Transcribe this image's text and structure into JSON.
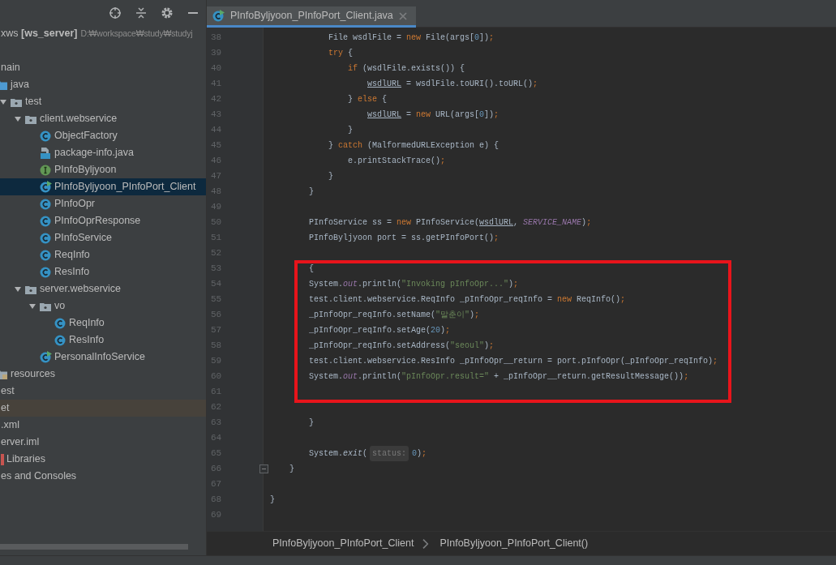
{
  "project_panel": {
    "header_row": "xws **[ws_server]**",
    "header_path": "D:₩workspace₩study₩studyj",
    "tree": [
      {
        "label": "nain",
        "kind": "item",
        "selected": false,
        "children": [
          {
            "label": "java",
            "kind": "source-folder",
            "selected": false,
            "children": [
              {
                "label": "test",
                "kind": "package",
                "selected": false,
                "expanded": true,
                "children": [
                  {
                    "label": "client.webservice",
                    "kind": "package",
                    "selected": false,
                    "expanded": true,
                    "children": [
                      {
                        "label": "ObjectFactory",
                        "kind": "class",
                        "selected": false
                      },
                      {
                        "label": "package-info.java",
                        "kind": "file",
                        "selected": false
                      },
                      {
                        "label": "PInfoByljyoon",
                        "kind": "interface",
                        "selected": false
                      },
                      {
                        "label": "PInfoByljyoon_PInfoPort_Client",
                        "kind": "runnable",
                        "selected": true
                      },
                      {
                        "label": "PInfoOpr",
                        "kind": "class",
                        "selected": false
                      },
                      {
                        "label": "PInfoOprResponse",
                        "kind": "class",
                        "selected": false
                      },
                      {
                        "label": "PInfoService",
                        "kind": "class",
                        "selected": false
                      },
                      {
                        "label": "ReqInfo",
                        "kind": "class",
                        "selected": false
                      },
                      {
                        "label": "ResInfo",
                        "kind": "class",
                        "selected": false
                      }
                    ]
                  },
                  {
                    "label": "server.webservice",
                    "kind": "package",
                    "selected": false,
                    "expanded": true,
                    "children": [
                      {
                        "label": "vo",
                        "kind": "package",
                        "selected": false,
                        "expanded": true,
                        "children": [
                          {
                            "label": "ReqInfo",
                            "kind": "class",
                            "selected": false
                          },
                          {
                            "label": "ResInfo",
                            "kind": "class",
                            "selected": false
                          }
                        ]
                      },
                      {
                        "label": "PersonalInfoService",
                        "kind": "runnable",
                        "selected": false
                      }
                    ]
                  }
                ]
              }
            ]
          },
          {
            "label": "resources",
            "kind": "resource-folder",
            "selected": false
          }
        ]
      },
      {
        "label": "est",
        "kind": "item",
        "selected": false
      },
      {
        "label": "et",
        "kind": "excluded-item",
        "selected": false
      },
      {
        "label": ".xml",
        "kind": "item",
        "selected": false
      },
      {
        "label": "erver.iml",
        "kind": "item",
        "selected": false
      },
      {
        "label": "Libraries",
        "kind": "library",
        "selected": false
      },
      {
        "label": "es and Consoles",
        "kind": "item",
        "selected": false
      }
    ]
  },
  "editor": {
    "tabs": [
      {
        "label": "PInfoByljyoon_PInfoPort_Client.java",
        "selected": true
      }
    ],
    "lines": [
      {
        "children": [
          {
            "children": [
              {
                "children": [
                  {
                    "number": "38",
                    "boxed": false,
                    "tokens": [
                      {
                        "text": "File wsdlFile = ",
                        "kind": "plain"
                      },
                      {
                        "text": "new",
                        "kind": "keyword"
                      },
                      {
                        "text": " File(args[",
                        "kind": "plain"
                      },
                      {
                        "text": "0",
                        "kind": "number"
                      },
                      {
                        "text": "])",
                        "kind": "plain"
                      },
                      {
                        "text": ";",
                        "kind": "keyword"
                      }
                    ]
                  },
                  {
                    "number": "39",
                    "boxed": false,
                    "tokens": [
                      {
                        "text": "try",
                        "kind": "keyword"
                      },
                      {
                        "text": " {",
                        "kind": "plain"
                      }
                    ]
                  },
                  {
                    "children": [
                      {
                        "number": "40",
                        "boxed": false,
                        "tokens": [
                          {
                            "text": "if",
                            "kind": "keyword"
                          },
                          {
                            "text": " (wsdlFile.exists()) {",
                            "kind": "plain"
                          }
                        ]
                      },
                      {
                        "children": [
                          {
                            "number": "41",
                            "boxed": false,
                            "tokens": [
                              {
                                "text": "wsdlURL",
                                "kind": "reassigned"
                              },
                              {
                                "text": " = wsdlFile.toURI().toURL()",
                                "kind": "plain"
                              },
                              {
                                "text": ";",
                                "kind": "keyword"
                              }
                            ]
                          }
                        ]
                      },
                      {
                        "number": "42",
                        "boxed": false,
                        "tokens": [
                          {
                            "text": "} ",
                            "kind": "plain"
                          },
                          {
                            "text": "else",
                            "kind": "keyword"
                          },
                          {
                            "text": " {",
                            "kind": "plain"
                          }
                        ]
                      },
                      {
                        "children": [
                          {
                            "number": "43",
                            "boxed": false,
                            "tokens": [
                              {
                                "text": "wsdlURL",
                                "kind": "reassigned"
                              },
                              {
                                "text": " = ",
                                "kind": "plain"
                              },
                              {
                                "text": "new",
                                "kind": "keyword"
                              },
                              {
                                "text": " URL(args[",
                                "kind": "plain"
                              },
                              {
                                "text": "0",
                                "kind": "number"
                              },
                              {
                                "text": "])",
                                "kind": "plain"
                              },
                              {
                                "text": ";",
                                "kind": "keyword"
                              }
                            ]
                          }
                        ]
                      },
                      {
                        "number": "44",
                        "boxed": false,
                        "tokens": [
                          {
                            "text": "}",
                            "kind": "plain"
                          }
                        ]
                      }
                    ]
                  },
                  {
                    "number": "45",
                    "boxed": false,
                    "tokens": [
                      {
                        "text": "} ",
                        "kind": "plain"
                      },
                      {
                        "text": "catch",
                        "kind": "keyword"
                      },
                      {
                        "text": " (MalformedURLException e) {",
                        "kind": "plain"
                      }
                    ]
                  },
                  {
                    "children": [
                      {
                        "number": "46",
                        "boxed": false,
                        "tokens": [
                          {
                            "text": "e.printStackTrace()",
                            "kind": "plain"
                          },
                          {
                            "text": ";",
                            "kind": "keyword"
                          }
                        ]
                      }
                    ]
                  },
                  {
                    "number": "47",
                    "boxed": false,
                    "tokens": [
                      {
                        "text": "}",
                        "kind": "plain"
                      }
                    ]
                  }
                ]
              },
              {
                "number": "48",
                "boxed": false,
                "tokens": [
                  {
                    "text": "}",
                    "kind": "plain"
                  }
                ]
              },
              {
                "number": "49",
                "boxed": false
              },
              {
                "number": "50",
                "boxed": false,
                "tokens": [
                  {
                    "text": "PInfoService ss = ",
                    "kind": "plain"
                  },
                  {
                    "text": "new",
                    "kind": "keyword"
                  },
                  {
                    "text": " PInfoService(",
                    "kind": "plain"
                  },
                  {
                    "text": "wsdlURL",
                    "kind": "reassigned"
                  },
                  {
                    "text": ", ",
                    "kind": "plain"
                  },
                  {
                    "text": "SERVICE_NAME",
                    "kind": "constant"
                  },
                  {
                    "text": ")",
                    "kind": "plain"
                  },
                  {
                    "text": ";",
                    "kind": "keyword"
                  }
                ]
              },
              {
                "number": "51",
                "boxed": false,
                "tokens": [
                  {
                    "text": "PInfoByljyoon port = ss.getPInfoPort()",
                    "kind": "plain"
                  },
                  {
                    "text": ";",
                    "kind": "keyword"
                  }
                ]
              },
              {
                "number": "52",
                "boxed": false
              },
              {
                "number": "53",
                "boxed": true,
                "tokens": [
                  {
                    "text": "{",
                    "kind": "plain"
                  }
                ]
              },
              {
                "number": "54",
                "boxed": true,
                "tokens": [
                  {
                    "text": "System.",
                    "kind": "plain"
                  },
                  {
                    "text": "out",
                    "kind": "constant"
                  },
                  {
                    "text": ".println(",
                    "kind": "plain"
                  },
                  {
                    "text": "\"Invoking pInfoOpr...\"",
                    "kind": "string"
                  },
                  {
                    "text": ")",
                    "kind": "plain"
                  },
                  {
                    "text": ";",
                    "kind": "keyword"
                  }
                ]
              },
              {
                "number": "55",
                "boxed": true,
                "tokens": [
                  {
                    "text": "test.client.webservice.ReqInfo _pInfoOpr_reqInfo = ",
                    "kind": "plain"
                  },
                  {
                    "text": "new",
                    "kind": "keyword"
                  },
                  {
                    "text": " ReqInfo()",
                    "kind": "plain"
                  },
                  {
                    "text": ";",
                    "kind": "keyword"
                  }
                ]
              },
              {
                "number": "56",
                "boxed": true,
                "tokens": [
                  {
                    "text": "_pInfoOpr_reqInfo.setName(",
                    "kind": "plain"
                  },
                  {
                    "text": "\"말춘이\"",
                    "kind": "string"
                  },
                  {
                    "text": ")",
                    "kind": "plain"
                  },
                  {
                    "text": ";",
                    "kind": "keyword"
                  }
                ]
              },
              {
                "number": "57",
                "boxed": true,
                "tokens": [
                  {
                    "text": "_pInfoOpr_reqInfo.setAge(",
                    "kind": "plain"
                  },
                  {
                    "text": "20",
                    "kind": "number"
                  },
                  {
                    "text": ")",
                    "kind": "plain"
                  },
                  {
                    "text": ";",
                    "kind": "keyword"
                  }
                ]
              },
              {
                "number": "58",
                "boxed": true,
                "tokens": [
                  {
                    "text": "_pInfoOpr_reqInfo.setAddress(",
                    "kind": "plain"
                  },
                  {
                    "text": "\"seoul\"",
                    "kind": "string"
                  },
                  {
                    "text": ")",
                    "kind": "plain"
                  },
                  {
                    "text": ";",
                    "kind": "keyword"
                  }
                ]
              },
              {
                "number": "59",
                "boxed": true,
                "tokens": [
                  {
                    "text": "test.client.webservice.ResInfo _pInfoOpr__return = port.pInfoOpr(_pInfoOpr_reqInfo)",
                    "kind": "plain"
                  },
                  {
                    "text": ";",
                    "kind": "keyword"
                  }
                ]
              },
              {
                "number": "60",
                "boxed": true,
                "tokens": [
                  {
                    "text": "System.",
                    "kind": "plain"
                  },
                  {
                    "text": "out",
                    "kind": "constant"
                  },
                  {
                    "text": ".println(",
                    "kind": "plain"
                  },
                  {
                    "text": "\"pInfoOpr.result=\"",
                    "kind": "string"
                  },
                  {
                    "text": " + _pInfoOpr__return.getResultMessage())",
                    "kind": "plain"
                  },
                  {
                    "text": ";",
                    "kind": "keyword"
                  }
                ]
              },
              {
                "number": "61",
                "boxed": true
              },
              {
                "number": "62",
                "boxed": false
              },
              {
                "number": "63",
                "boxed": false,
                "tokens": [
                  {
                    "text": "}",
                    "kind": "plain"
                  }
                ]
              },
              {
                "number": "64",
                "boxed": false
              },
              {
                "number": "65",
                "boxed": false,
                "tokens": [
                  {
                    "text": "System.",
                    "kind": "plain"
                  },
                  {
                    "text": "exit",
                    "kind": "static"
                  },
                  {
                    "text": "(",
                    "kind": "plain"
                  },
                  {
                    "text": "status:",
                    "kind": "hint"
                  },
                  {
                    "text": "0",
                    "kind": "number"
                  },
                  {
                    "text": ")",
                    "kind": "plain"
                  },
                  {
                    "text": ";",
                    "kind": "keyword"
                  }
                ]
              }
            ]
          },
          {
            "number": "66",
            "boxed": false,
            "folded_marker": true,
            "tokens": [
              {
                "text": "}",
                "kind": "plain"
              }
            ]
          }
        ]
      },
      {
        "number": "67",
        "boxed": false
      },
      {
        "number": "68",
        "boxed": false,
        "tokens": [
          {
            "text": "}",
            "kind": "plain"
          }
        ]
      },
      {
        "number": "69",
        "boxed": false
      }
    ],
    "breadcrumbs": [
      "PInfoByljyoon_PInfoPort_Client",
      "PInfoByljyoon_PInfoPort_Client()"
    ]
  }
}
